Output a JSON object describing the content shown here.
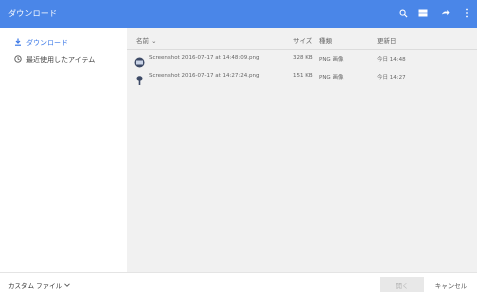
{
  "window": {
    "title": "ダウンロード",
    "accent_color": "#4a86e8"
  },
  "toolbar": {
    "icons": [
      "search-icon",
      "view-grid-icon",
      "share-icon",
      "more-vert-icon"
    ]
  },
  "sidebar": {
    "items": [
      {
        "label": "ダウンロード",
        "icon": "download-icon",
        "active": true
      },
      {
        "label": "最近使用したアイテム",
        "icon": "recent-clock-icon",
        "active": false
      }
    ]
  },
  "table": {
    "headers": {
      "name": "名前 ⌄",
      "size": "サイズ",
      "type": "種類",
      "date": "更新日"
    },
    "rows": [
      {
        "name": "Screenshot 2016-07-17 at 14:48:09.png",
        "size": "328 KB",
        "type": "PNG 画像",
        "date": "今日 14:48"
      },
      {
        "name": "Screenshot 2016-07-17 at 14:27:24.png",
        "size": "151 KB",
        "type": "PNG 画像",
        "date": "今日 14:27"
      }
    ]
  },
  "footer": {
    "file_type": "カスタム ファイル",
    "open_label": "開く",
    "cancel_label": "キャンセル"
  }
}
